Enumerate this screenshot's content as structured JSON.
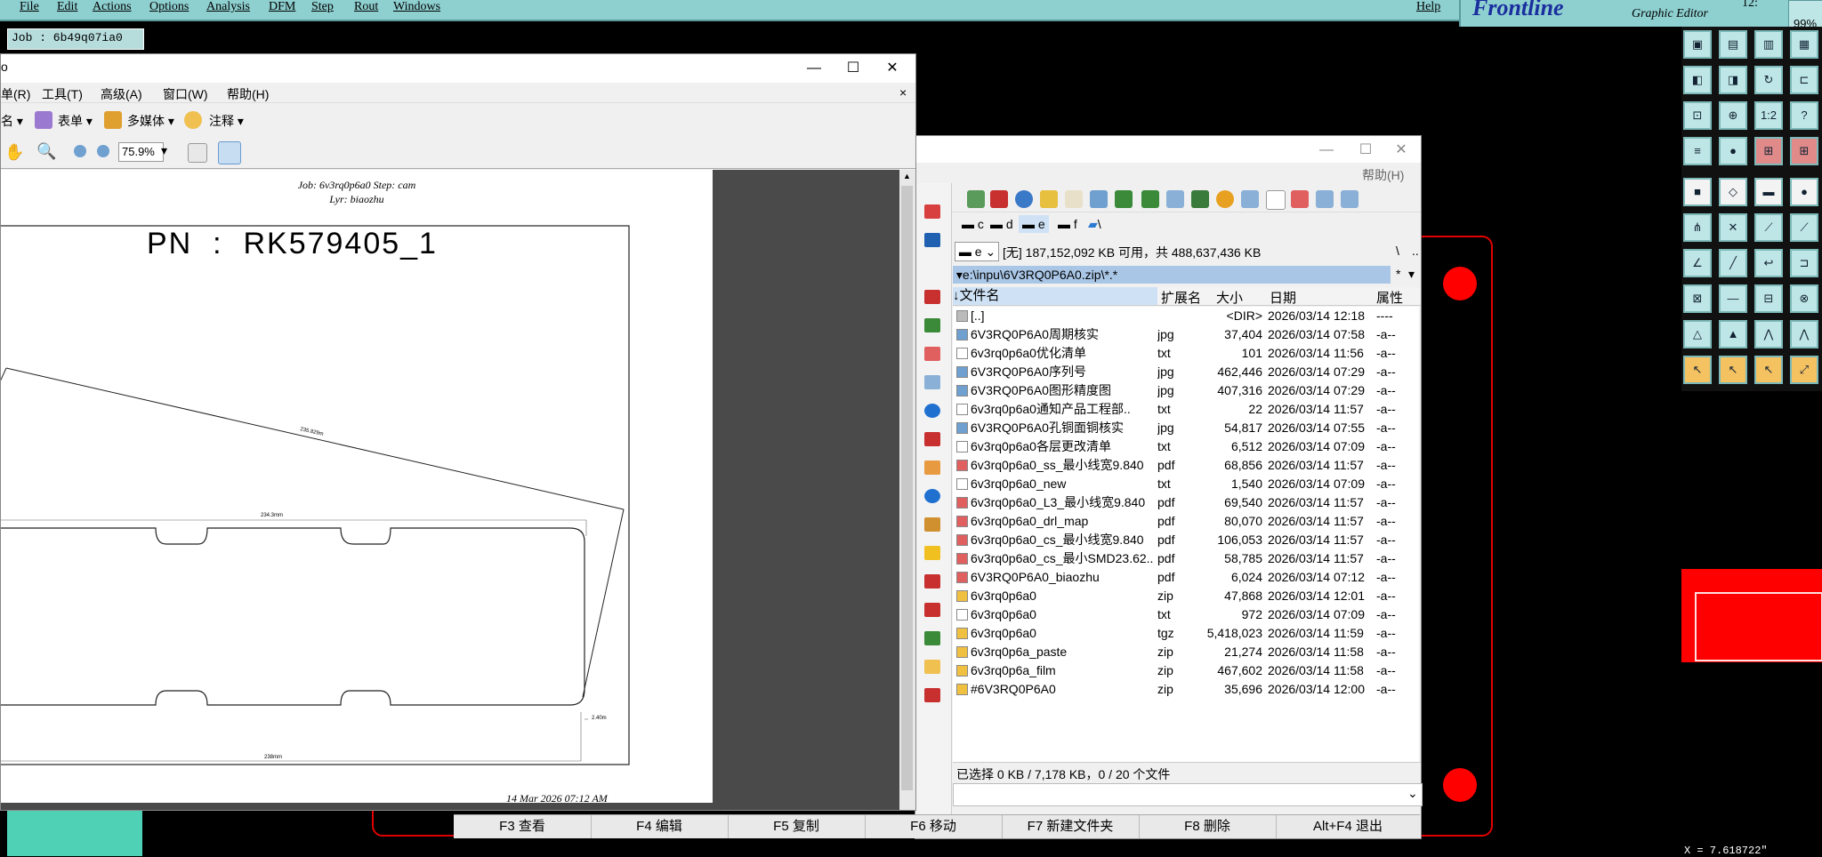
{
  "cam": {
    "menu": [
      "File",
      "Edit",
      "Actions",
      "Options",
      "Analysis",
      "DFM",
      "Step",
      "Rout",
      "Windows"
    ],
    "help": "Help",
    "logo": "Frontline",
    "subtitle": "Graphic Editor",
    "clock": "12:",
    "zoom_badge": "99%",
    "job_label": "Job : 6b49q07ia0",
    "coord_readout": "X = 7.618722\"",
    "tool_labels": {
      "ratio": "1:2",
      "help": "?"
    },
    "colors": {
      "background": "#000000",
      "menubar": "#8ecfd0",
      "outline": "#e00000",
      "logo": "#1a2e9e"
    }
  },
  "pdf": {
    "title_fragment": "o",
    "menu": [
      "单(R)",
      "工具(T)",
      "高级(A)",
      "窗口(W)",
      "帮助(H)"
    ],
    "toolbar1": [
      "名",
      "表单",
      "多媒体",
      "注释"
    ],
    "zoom": "75.9%",
    "page": {
      "header_line1": "Job: 6v3rq0p6a0  Step: cam",
      "header_line2": "Lyr: biaozhu",
      "pn": "PN  :  RK579405_1",
      "dim_diagonal": "235.829m",
      "dim_top": "234.3mm",
      "dim_right": "2.40m",
      "dim_bottom": "238mm",
      "footer": "14 Mar 2026 07:12 AM"
    }
  },
  "fm": {
    "help": "帮助(H)",
    "drives": [
      "c",
      "d",
      "e",
      "f",
      "\\"
    ],
    "drive_select": "e",
    "drive_info": "[无]  187,152,092 KB 可用，共 488,637,436 KB",
    "path": "e:\\inpu\\6V3RQ0P6A0.zip\\*.*",
    "columns": [
      "文件名",
      "扩展名",
      "大小",
      "日期",
      "属性"
    ],
    "files": [
      {
        "icon": "up",
        "name": "[..]",
        "ext": "",
        "size": "<DIR>",
        "date": "2026/03/14 12:18",
        "attr": "----"
      },
      {
        "icon": "img",
        "name": "6V3RQ0P6A0周期核实",
        "ext": "jpg",
        "size": "37,404",
        "date": "2026/03/14 07:58",
        "attr": "-a--"
      },
      {
        "icon": "txt",
        "name": "6v3rq0p6a0优化清单",
        "ext": "txt",
        "size": "101",
        "date": "2026/03/14 11:56",
        "attr": "-a--"
      },
      {
        "icon": "img",
        "name": "6V3RQ0P6A0序列号",
        "ext": "jpg",
        "size": "462,446",
        "date": "2026/03/14 07:29",
        "attr": "-a--"
      },
      {
        "icon": "img",
        "name": "6V3RQ0P6A0图形精度图",
        "ext": "jpg",
        "size": "407,316",
        "date": "2026/03/14 07:29",
        "attr": "-a--"
      },
      {
        "icon": "txt",
        "name": "6v3rq0p6a0通知产品工程部..",
        "ext": "txt",
        "size": "22",
        "date": "2026/03/14 11:57",
        "attr": "-a--"
      },
      {
        "icon": "img",
        "name": "6V3RQ0P6A0孔铜面铜核实",
        "ext": "jpg",
        "size": "54,817",
        "date": "2026/03/14 07:55",
        "attr": "-a--"
      },
      {
        "icon": "txt",
        "name": "6v3rq0p6a0各层更改清单",
        "ext": "txt",
        "size": "6,512",
        "date": "2026/03/14 07:09",
        "attr": "-a--"
      },
      {
        "icon": "pdf",
        "name": "6v3rq0p6a0_ss_最小线宽9.840",
        "ext": "pdf",
        "size": "68,856",
        "date": "2026/03/14 11:57",
        "attr": "-a--"
      },
      {
        "icon": "txt",
        "name": "6v3rq0p6a0_new",
        "ext": "txt",
        "size": "1,540",
        "date": "2026/03/14 07:09",
        "attr": "-a--"
      },
      {
        "icon": "pdf",
        "name": "6v3rq0p6a0_L3_最小线宽9.840",
        "ext": "pdf",
        "size": "69,540",
        "date": "2026/03/14 11:57",
        "attr": "-a--"
      },
      {
        "icon": "pdf",
        "name": "6v3rq0p6a0_drl_map",
        "ext": "pdf",
        "size": "80,070",
        "date": "2026/03/14 11:57",
        "attr": "-a--"
      },
      {
        "icon": "pdf",
        "name": "6v3rq0p6a0_cs_最小线宽9.840",
        "ext": "pdf",
        "size": "106,053",
        "date": "2026/03/14 11:57",
        "attr": "-a--"
      },
      {
        "icon": "pdf",
        "name": "6v3rq0p6a0_cs_最小SMD23.62..",
        "ext": "pdf",
        "size": "58,785",
        "date": "2026/03/14 11:57",
        "attr": "-a--"
      },
      {
        "icon": "pdf",
        "name": "6V3RQ0P6A0_biaozhu",
        "ext": "pdf",
        "size": "6,024",
        "date": "2026/03/14 07:12",
        "attr": "-a--"
      },
      {
        "icon": "zip",
        "name": "6v3rq0p6a0",
        "ext": "zip",
        "size": "47,868",
        "date": "2026/03/14 12:01",
        "attr": "-a--"
      },
      {
        "icon": "txt",
        "name": "6v3rq0p6a0",
        "ext": "txt",
        "size": "972",
        "date": "2026/03/14 07:09",
        "attr": "-a--"
      },
      {
        "icon": "zip",
        "name": "6v3rq0p6a0",
        "ext": "tgz",
        "size": "5,418,023",
        "date": "2026/03/14 11:59",
        "attr": "-a--"
      },
      {
        "icon": "zip",
        "name": "6v3rq0p6a_paste",
        "ext": "zip",
        "size": "21,274",
        "date": "2026/03/14 11:58",
        "attr": "-a--"
      },
      {
        "icon": "zip",
        "name": "6v3rq0p6a_film",
        "ext": "zip",
        "size": "467,602",
        "date": "2026/03/14 11:58",
        "attr": "-a--"
      },
      {
        "icon": "zip",
        "name": "#6V3RQ0P6A0",
        "ext": "zip",
        "size": "35,696",
        "date": "2026/03/14 12:00",
        "attr": "-a--"
      }
    ],
    "status": "已选择 0 KB / 7,178 KB，0 / 20 个文件",
    "fkeys": [
      "F3 查看",
      "F4 编辑",
      "F5 复制",
      "F6 移动",
      "F7 新建文件夹",
      "F8 删除",
      "Alt+F4 退出"
    ]
  }
}
